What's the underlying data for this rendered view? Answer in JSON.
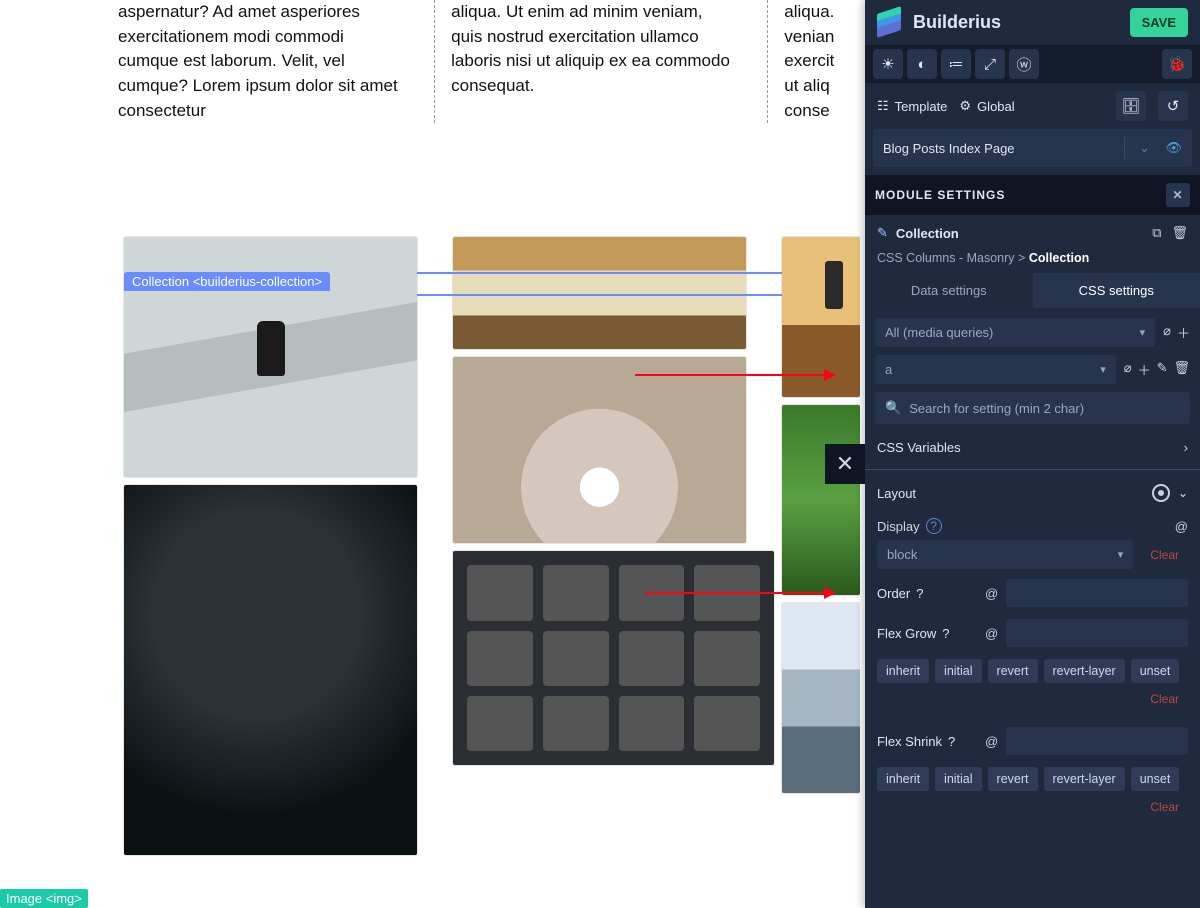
{
  "brand": "Builderius",
  "save_label": "SAVE",
  "subbar": {
    "template": "Template",
    "global": "Global"
  },
  "crumb_title": "Blog Posts Index Page",
  "module_settings_title": "MODULE SETTINGS",
  "module": {
    "name": "Collection",
    "breadcrumb_parent": "CSS Columns - Masonry",
    "breadcrumb_sep": ">",
    "breadcrumb_current": "Collection"
  },
  "tabs": {
    "data": "Data settings",
    "css": "CSS settings"
  },
  "selectors": {
    "media": "All (media queries)",
    "selector": "a"
  },
  "search_placeholder": "Search for setting (min 2 char)",
  "groups": {
    "css_vars": "CSS Variables",
    "layout": "Layout"
  },
  "props": {
    "display": {
      "label": "Display",
      "value": "block",
      "clear": "Clear"
    },
    "order": "Order",
    "flex_grow": "Flex Grow",
    "flex_shrink": "Flex Shrink"
  },
  "keyword_chips": [
    "inherit",
    "initial",
    "revert",
    "revert-layer",
    "unset"
  ],
  "clear_label": "Clear",
  "canvas": {
    "col1": "aspernatur? Ad amet asperiores exercitationem modi commodi cumque est laborum. Velit, vel cumque? Lorem ipsum dolor sit amet consectetur",
    "col2": "aliqua. Ut enim ad minim veniam, quis nostrud exercitation ullamco laboris nisi ut aliquip ex ea commodo consequat.",
    "col3": "aliqua.\nvenian\nexercit\nut aliq\nconse",
    "selection_label": "Collection <builderius-collection>",
    "image_label": "Image <img>"
  }
}
